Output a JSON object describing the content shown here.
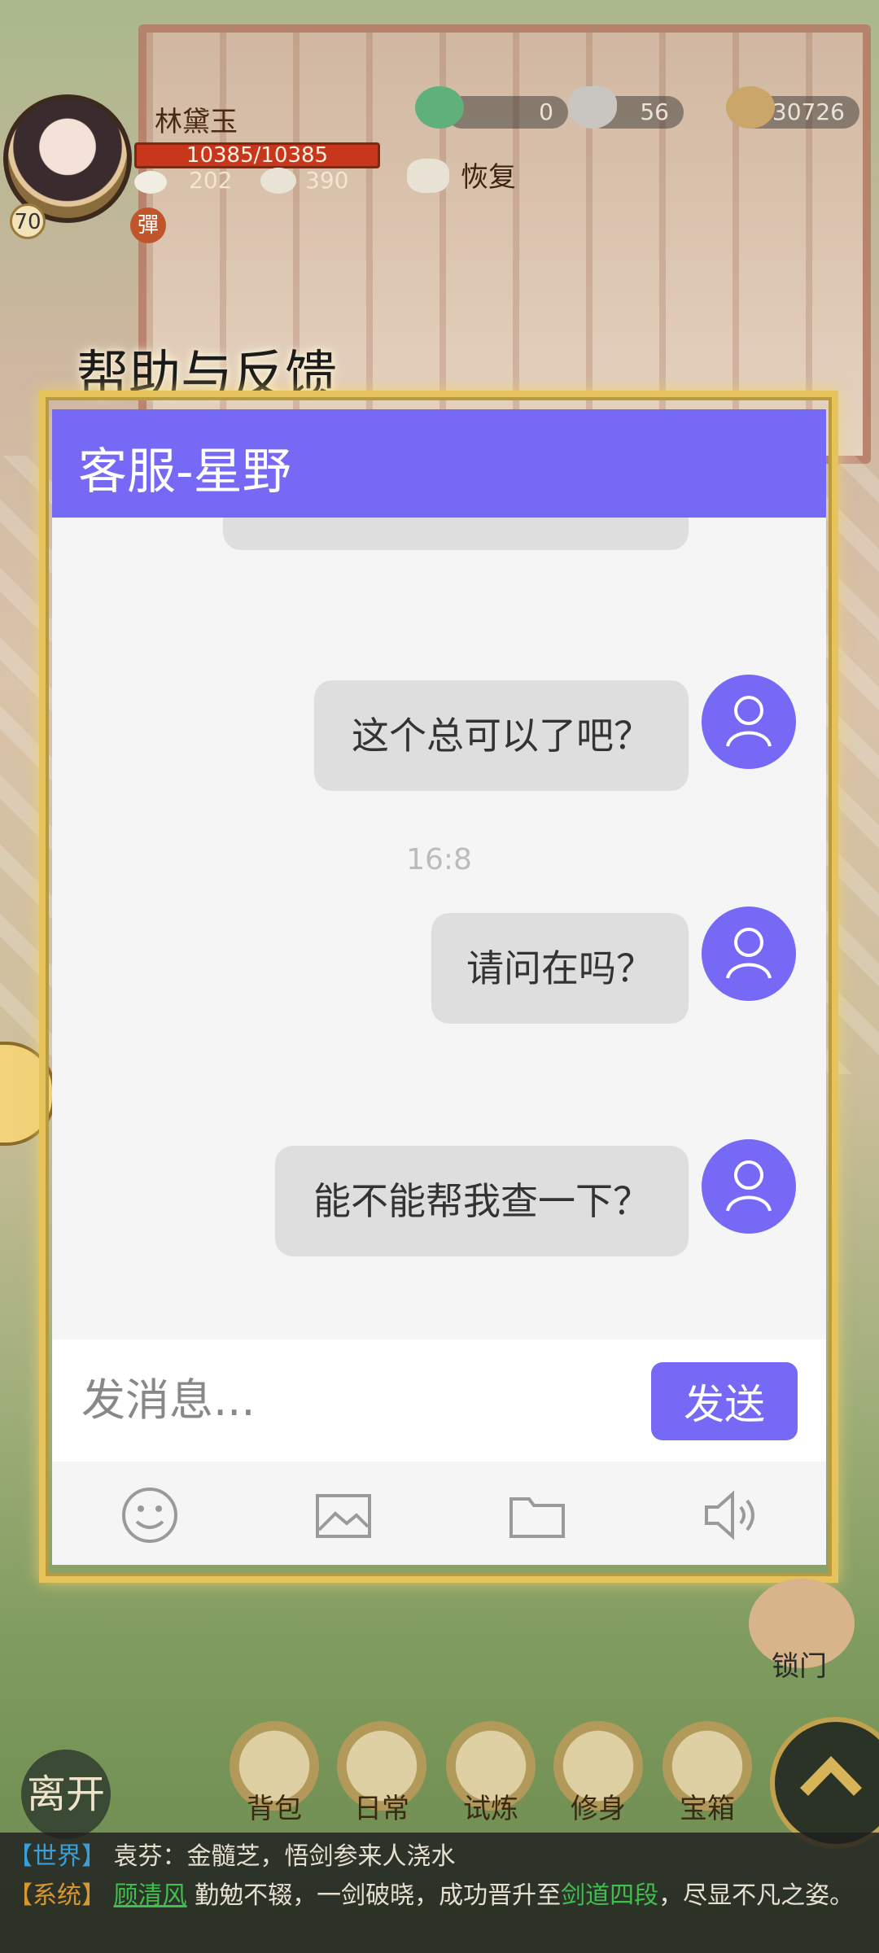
{
  "game": {
    "player": {
      "name": "林黛玉",
      "level": "70",
      "hp": "10385/10385",
      "stat1": "202",
      "stat2": "390",
      "seal_char": "彈"
    },
    "resources": [
      "0",
      "56",
      "30726"
    ],
    "restore_label": "恢复",
    "bottom_buttons": [
      "背包",
      "日常",
      "试炼",
      "修身",
      "宝箱"
    ],
    "leave_label": "离开",
    "lock_label": "锁门"
  },
  "help": {
    "title": "帮助与反馈",
    "header": "客服-星野",
    "messages": [
      {
        "text": "这个总可以了吧？"
      },
      {
        "text": "请问在吗？"
      },
      {
        "text": "能不能帮我查一下？"
      }
    ],
    "time": "16:8",
    "input_placeholder": "发消息...",
    "send_label": "发送",
    "tools": [
      "smile-icon",
      "image-icon",
      "folder-icon",
      "speaker-icon"
    ],
    "colors": {
      "accent": "#7669f6",
      "bubble": "#dedede"
    }
  },
  "log": {
    "line1": {
      "channel": "【世界】",
      "text": "袁芬：金髓芝，悟剑参来人浇水"
    },
    "line2": {
      "channel": "【系统】",
      "name": "顾清风",
      "text1": "勤勉不辍，一剑破晓，成功晋升至",
      "rank": "剑道四段",
      "text2": "，尽显不凡之姿。"
    }
  }
}
